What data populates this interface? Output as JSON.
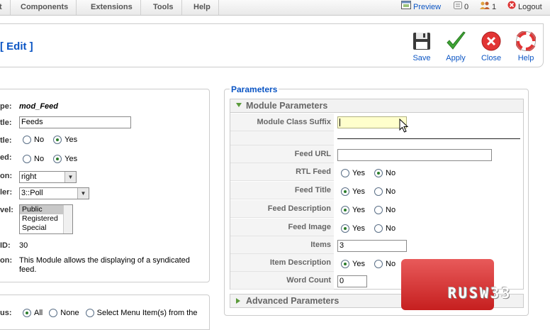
{
  "menu": [
    "t",
    "Components",
    "Extensions",
    "Tools",
    "Help"
  ],
  "status": {
    "preview": "Preview",
    "messages": "0",
    "users": "1",
    "logout": "Logout"
  },
  "page_title": "[ Edit ]",
  "toolbar": {
    "save": "Save",
    "apply": "Apply",
    "close": "Close",
    "help": "Help"
  },
  "details": {
    "type_label": "pe:",
    "type_value": "mod_Feed",
    "title_label": "tle:",
    "title_value": "Feeds",
    "show_title_label": "tle:",
    "enabled_label": "ed:",
    "position_label": "on:",
    "position_value": "right",
    "order_label": "ler:",
    "order_value": "3::Poll",
    "access_label": "vel:",
    "access_options": [
      "Public",
      "Registered",
      "Special"
    ],
    "id_label": "ID:",
    "id_value": "30",
    "description_label": "on:",
    "description_value": "This Module allows the displaying of a syndicated feed.",
    "no": "No",
    "yes": "Yes"
  },
  "menu_assignment": {
    "label": "us:",
    "all": "All",
    "none": "None",
    "select": "Select Menu Item(s) from the"
  },
  "parameters": {
    "legend": "Parameters",
    "module_params_title": "Module Parameters",
    "advanced_params_title": "Advanced Parameters",
    "rows": {
      "module_class_suffix": "Module Class Suffix",
      "feed_url": "Feed URL",
      "rtl_feed": "RTL Feed",
      "feed_title": "Feed Title",
      "feed_description": "Feed Description",
      "feed_image": "Feed Image",
      "items": "Items",
      "item_description": "Item Description",
      "word_count": "Word Count"
    },
    "items_value": "3",
    "word_count_value": "0",
    "yes": "Yes",
    "no": "No"
  },
  "watermark": "RUSW33"
}
